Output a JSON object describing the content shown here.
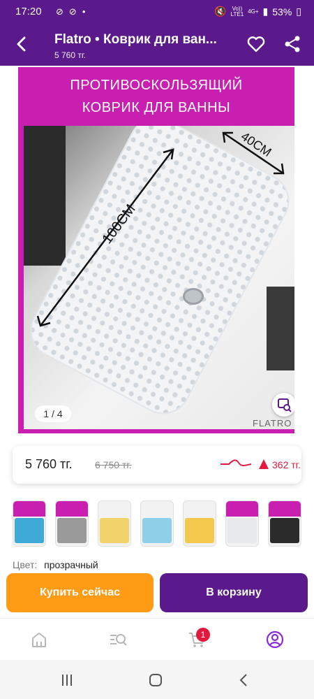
{
  "status": {
    "time": "17:20",
    "battery": "53%",
    "network_top": "Vo))",
    "network_bottom": "LTE1",
    "net_4g": "4G+"
  },
  "header": {
    "title": "Flatro • Коврик для ван...",
    "subtitle": "5 760 тг."
  },
  "gallery": {
    "banner_line1": "ПРОТИВОСКОЛЬЗЯЩИЙ",
    "banner_line2": "КОВРИК ДЛЯ ВАННЫ",
    "length_label": "100СМ",
    "width_label": "40СМ",
    "brand": "FLATRO",
    "counter": "1 / 4"
  },
  "price": {
    "current": "5 760 тг.",
    "old": "6 750 тг.",
    "delta": "362 тг."
  },
  "thumbnails": [
    {
      "name": "thumb-1",
      "color": "#3fa9d8"
    },
    {
      "name": "thumb-2",
      "color": "#9a9a9a"
    },
    {
      "name": "thumb-3",
      "color": "#f2d36b"
    },
    {
      "name": "thumb-4",
      "color": "#8dd0e8"
    },
    {
      "name": "thumb-5",
      "color": "#f2c94c"
    },
    {
      "name": "thumb-6",
      "color": "#e6e8ea"
    },
    {
      "name": "thumb-7",
      "color": "#2b2b2b"
    }
  ],
  "color": {
    "label": "Цвет:",
    "value": "прозрачный"
  },
  "buttons": {
    "buy": "Купить сейчас",
    "cart": "В корзину"
  },
  "tabbar": {
    "cart_badge": "1"
  },
  "colors": {
    "brand_purple": "#5a1a8c",
    "banner_magenta": "#c81fb0",
    "buy_orange": "#ff9b14",
    "alert_red": "#e3183e"
  }
}
